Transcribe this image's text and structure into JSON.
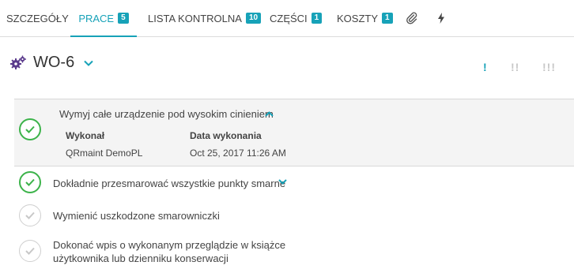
{
  "tabs": [
    {
      "label": "SZCZEGÓŁY"
    },
    {
      "label": "PRACE",
      "badge": "5"
    },
    {
      "label": "LISTA KONTROLNA",
      "badge": "10"
    },
    {
      "label": "CZĘŚCI",
      "badge": "1"
    },
    {
      "label": "KOSZTY",
      "badge": "1"
    }
  ],
  "tab_icons": [
    "paperclip-icon",
    "lightning-icon"
  ],
  "header": {
    "title": "WO-6",
    "priority": [
      "!",
      "!!",
      "!!!"
    ]
  },
  "tasks": [
    {
      "text": "Wymyj całe urządzenie pod wysokim cinieniem",
      "done": true,
      "expanded": true,
      "details": {
        "performed_by_label": "Wykonał",
        "performed_by": "QRmaint DemoPL",
        "date_label": "Data wykonania",
        "date": "Oct 25, 2017 11:26 AM"
      }
    },
    {
      "text": "Dokładnie przesmarować wszystkie punkty smarne",
      "done": true,
      "expanded": false
    },
    {
      "text": "Wymienić uszkodzone smarowniczki",
      "done": false
    },
    {
      "text_line1": "Dokonać wpis o wykonanym przeglądzie w książce",
      "text_line2": "użytkownika lub dzienniku konserwacji",
      "done": false
    }
  ],
  "colors": {
    "accent": "#17a2b8",
    "done": "#3cb34a",
    "gear": "#5b3a8c"
  }
}
